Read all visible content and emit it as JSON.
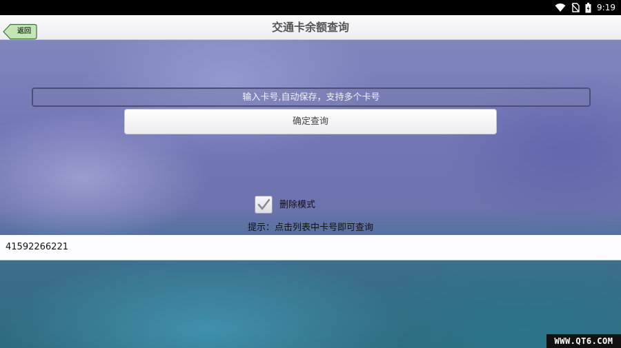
{
  "status_bar": {
    "time": "9:19",
    "icons": [
      "wifi-icon",
      "no-sim-icon",
      "battery-icon"
    ]
  },
  "header": {
    "back_label": "返回",
    "title": "交通卡余额查询"
  },
  "form": {
    "card_input_placeholder": "输入卡号,自动保存，支持多个卡号",
    "card_input_value": "",
    "confirm_label": "确定查询"
  },
  "options": {
    "delete_mode_label": "删除模式",
    "delete_mode_checked": true,
    "hint": "提示：点击列表中卡号即可查询"
  },
  "card_list": {
    "items": [
      "41592266221"
    ]
  },
  "watermark": "WWW.QT6.COM",
  "colors": {
    "title_text": "#555555",
    "back_button_green": "#c4e6b4",
    "background_top": "#7f86bd",
    "background_bottom": "#2f6a7e"
  }
}
